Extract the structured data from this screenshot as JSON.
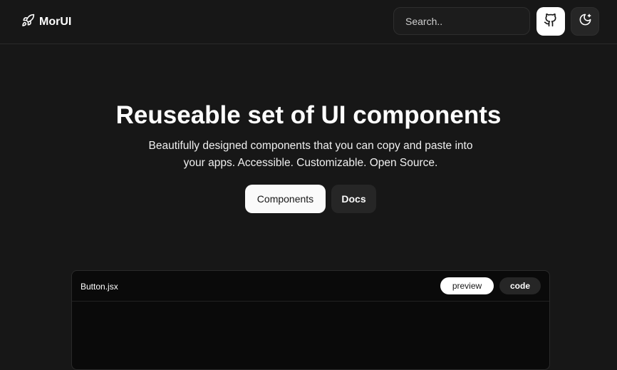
{
  "header": {
    "logo_icon": "rocket-icon",
    "brand": "MorUI",
    "search_placeholder": "Search..",
    "github_icon": "github-icon",
    "theme_icon": "moon-sparkle-icon"
  },
  "hero": {
    "title": "Reuseable set of UI components",
    "subtitle": "Beautifully designed components that you can copy and paste into your apps. Accessible. Customizable. Open Source.",
    "primary_button": "Components",
    "secondary_button": "Docs"
  },
  "preview_panel": {
    "file_name": "Button.jsx",
    "tabs": [
      "preview",
      "code"
    ],
    "active_tab": "preview"
  },
  "colors": {
    "background": "#171717",
    "surface": "#262626",
    "panel": "#0a0a0a",
    "primary": "#fafafa"
  }
}
